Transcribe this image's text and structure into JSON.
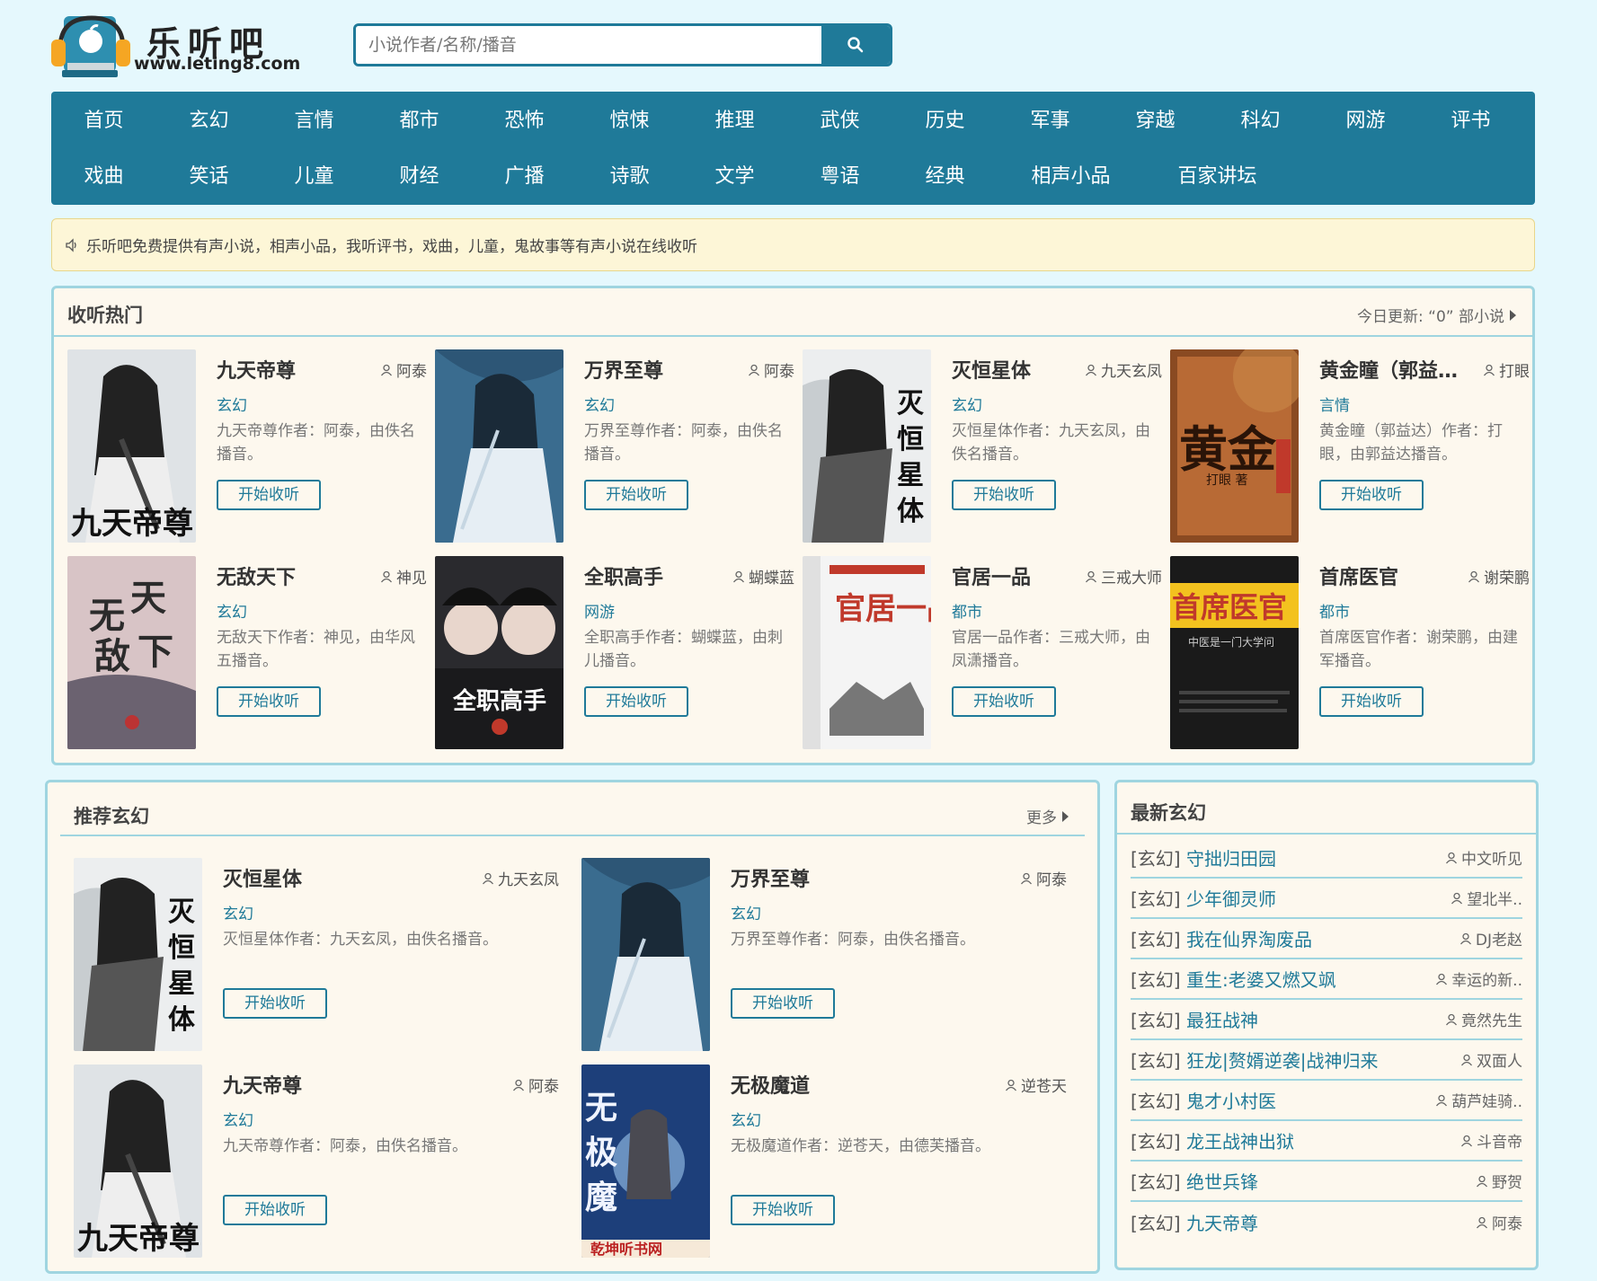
{
  "site": {
    "title": "乐听吧",
    "url": "www.leting8.com"
  },
  "search": {
    "placeholder": "小说作者/名称/播音"
  },
  "nav": {
    "row1": [
      "首页",
      "玄幻",
      "言情",
      "都市",
      "恐怖",
      "惊悚",
      "推理",
      "武侠",
      "历史",
      "军事",
      "穿越",
      "科幻",
      "网游",
      "评书"
    ],
    "row2": [
      "戏曲",
      "笑话",
      "儿童",
      "财经",
      "广播",
      "诗歌",
      "文学",
      "粤语",
      "经典",
      "相声小品",
      "百家讲坛"
    ]
  },
  "notice": {
    "text": "乐听吧免费提供有声小说，相声小品，我听评书，戏曲，儿童，鬼故事等有声小说在线收听"
  },
  "hot": {
    "title": "收听热门",
    "update_text": "今日更新: “0” 部小说",
    "button_label": "开始收听",
    "items": [
      {
        "title": "九天帝尊",
        "author": "阿泰",
        "category": "玄幻",
        "desc": "九天帝尊作者：阿泰，由佚名播音。",
        "cover": "jiutian"
      },
      {
        "title": "万界至尊",
        "author": "阿泰",
        "category": "玄幻",
        "desc": "万界至尊作者：阿泰，由佚名播音。",
        "cover": "wanjie"
      },
      {
        "title": "灭恒星体",
        "author": "九天玄凤",
        "category": "玄幻",
        "desc": "灭恒星体作者：九天玄凤，由佚名播音。",
        "cover": "mieheng"
      },
      {
        "title": "黄金瞳（郭益…",
        "author": "打眼",
        "category": "言情",
        "desc": "黄金瞳（郭益达）作者：打眼，由郭益达播音。",
        "cover": "huangjin"
      },
      {
        "title": "无敌天下",
        "author": "神见",
        "category": "玄幻",
        "desc": "无敌天下作者：神见，由华风五播音。",
        "cover": "wudi"
      },
      {
        "title": "全职高手",
        "author": "蝴蝶蓝",
        "category": "网游",
        "desc": "全职高手作者：蝴蝶蓝，由刺儿播音。",
        "cover": "quanzhi"
      },
      {
        "title": "官居一品",
        "author": "三戒大师",
        "category": "都市",
        "desc": "官居一品作者：三戒大师，由凤潇播音。",
        "cover": "guanju"
      },
      {
        "title": "首席医官",
        "author": "谢荣鹏",
        "category": "都市",
        "desc": "首席医官作者：谢荣鹏，由建军播音。",
        "cover": "shouxi"
      }
    ]
  },
  "recommend": {
    "title": "推荐玄幻",
    "more_label": "更多",
    "button_label": "开始收听",
    "items": [
      {
        "title": "灭恒星体",
        "author": "九天玄凤",
        "category": "玄幻",
        "desc": "灭恒星体作者：九天玄凤，由佚名播音。",
        "cover": "mieheng"
      },
      {
        "title": "万界至尊",
        "author": "阿泰",
        "category": "玄幻",
        "desc": "万界至尊作者：阿泰，由佚名播音。",
        "cover": "wanjie"
      },
      {
        "title": "九天帝尊",
        "author": "阿泰",
        "category": "玄幻",
        "desc": "九天帝尊作者：阿泰，由佚名播音。",
        "cover": "jiutian"
      },
      {
        "title": "无极魔道",
        "author": "逆苍天",
        "category": "玄幻",
        "desc": "无极魔道作者：逆苍天，由德芙播音。",
        "cover": "wuji"
      }
    ]
  },
  "latest": {
    "title": "最新玄幻",
    "items": [
      {
        "category": "[玄幻]",
        "title": "守拙归田园",
        "author": "中文听见"
      },
      {
        "category": "[玄幻]",
        "title": "少年御灵师",
        "author": "望北半.."
      },
      {
        "category": "[玄幻]",
        "title": "我在仙界淘废品",
        "author": "DJ老赵"
      },
      {
        "category": "[玄幻]",
        "title": "重生:老婆又燃又飒",
        "author": "幸运的新.."
      },
      {
        "category": "[玄幻]",
        "title": "最狂战神",
        "author": "竟然先生"
      },
      {
        "category": "[玄幻]",
        "title": "狂龙|赘婿逆袭|战神归来",
        "author": "双面人"
      },
      {
        "category": "[玄幻]",
        "title": "鬼才小村医",
        "author": "葫芦娃骑.."
      },
      {
        "category": "[玄幻]",
        "title": "龙王战神出狱",
        "author": "斗音帝"
      },
      {
        "category": "[玄幻]",
        "title": "绝世兵锋",
        "author": "野贺"
      },
      {
        "category": "[玄幻]",
        "title": "九天帝尊",
        "author": "阿泰"
      }
    ]
  },
  "colors": {
    "primary": "#1f7a99",
    "background": "#e5f8fd",
    "panel_bg": "#fdf8ee",
    "panel_border": "#9fd5e0",
    "notice_bg": "#fdf6d7"
  }
}
